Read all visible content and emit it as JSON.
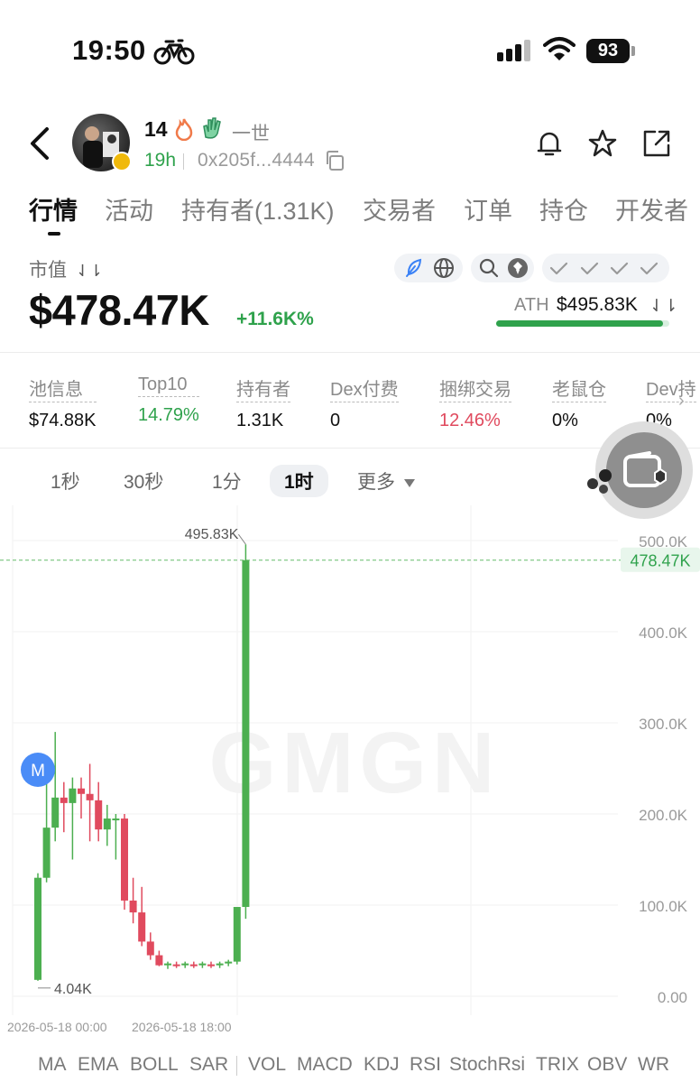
{
  "status_bar": {
    "time": "19:50",
    "battery": "93"
  },
  "token": {
    "name": "14",
    "subtitle": "一世",
    "age": "19h",
    "address": "0x205f...4444"
  },
  "tabs": [
    "行情",
    "活动",
    "持有者(1.31K)",
    "交易者",
    "订单",
    "持仓",
    "开发者"
  ],
  "market": {
    "cap_label": "市值",
    "sort_glyph": "⇃⇂",
    "cap_value": "$478.47K",
    "change": "+11.6K%",
    "ath_label": "ATH",
    "ath_value": "$495.83K",
    "ath_progress": 0.965
  },
  "stats": [
    {
      "label": "池信息",
      "value": "$74.88K",
      "tone": "normal"
    },
    {
      "label": "Top10",
      "value": "14.79%",
      "tone": "green"
    },
    {
      "label": "持有者",
      "value": "1.31K",
      "tone": "normal"
    },
    {
      "label": "Dex付费",
      "value": "0",
      "tone": "normal"
    },
    {
      "label": "捆绑交易",
      "value": "12.46%",
      "tone": "red"
    },
    {
      "label": "老鼠仓",
      "value": "0%",
      "tone": "normal"
    },
    {
      "label": "Dev持",
      "value": "0%",
      "tone": "normal"
    }
  ],
  "intervals": [
    "1秒",
    "30秒",
    "1分",
    "1时",
    "更多"
  ],
  "active_interval": "1时",
  "chart_data": {
    "type": "candlestick",
    "watermark": "GMGN",
    "y_ticks": [
      "500.0K",
      "400.0K",
      "300.0K",
      "200.0K",
      "100.0K",
      "0.00"
    ],
    "y_values": [
      500,
      400,
      300,
      200,
      100,
      0
    ],
    "x_ticks": [
      "2026-05-18 00:00",
      "2026-05-18 18:00"
    ],
    "high_label": "495.83K",
    "low_label": "4.04K",
    "current_label": "478.47K",
    "current_value": 478.47,
    "marker": "M",
    "colors": {
      "up": "#4caf50",
      "down": "#e04a5e"
    },
    "candles": [
      {
        "o": 18,
        "h": 135,
        "l": 17,
        "c": 130
      },
      {
        "o": 130,
        "h": 260,
        "l": 125,
        "c": 185
      },
      {
        "o": 185,
        "h": 290,
        "l": 170,
        "c": 218
      },
      {
        "o": 218,
        "h": 235,
        "l": 180,
        "c": 212
      },
      {
        "o": 212,
        "h": 240,
        "l": 150,
        "c": 228
      },
      {
        "o": 228,
        "h": 240,
        "l": 195,
        "c": 222
      },
      {
        "o": 222,
        "h": 255,
        "l": 170,
        "c": 215
      },
      {
        "o": 215,
        "h": 235,
        "l": 170,
        "c": 183
      },
      {
        "o": 183,
        "h": 210,
        "l": 165,
        "c": 195
      },
      {
        "o": 195,
        "h": 200,
        "l": 150,
        "c": 195
      },
      {
        "o": 195,
        "h": 200,
        "l": 95,
        "c": 105
      },
      {
        "o": 105,
        "h": 130,
        "l": 80,
        "c": 92
      },
      {
        "o": 92,
        "h": 120,
        "l": 55,
        "c": 60
      },
      {
        "o": 60,
        "h": 70,
        "l": 40,
        "c": 45
      },
      {
        "o": 45,
        "h": 50,
        "l": 33,
        "c": 34
      },
      {
        "o": 34,
        "h": 38,
        "l": 30,
        "c": 36
      },
      {
        "o": 35,
        "h": 38,
        "l": 31,
        "c": 34
      },
      {
        "o": 34,
        "h": 38,
        "l": 31,
        "c": 36
      },
      {
        "o": 35,
        "h": 38,
        "l": 31,
        "c": 34
      },
      {
        "o": 34,
        "h": 38,
        "l": 31,
        "c": 36
      },
      {
        "o": 35,
        "h": 38,
        "l": 31,
        "c": 34
      },
      {
        "o": 34,
        "h": 38,
        "l": 31,
        "c": 36
      },
      {
        "o": 36,
        "h": 40,
        "l": 33,
        "c": 38
      },
      {
        "o": 38,
        "h": 45,
        "l": 35,
        "c": 98
      },
      {
        "o": 98,
        "h": 495.83,
        "l": 85,
        "c": 478.47
      }
    ]
  },
  "indicators": [
    "MA",
    "EMA",
    "BOLL",
    "SAR",
    "VOL",
    "MACD",
    "KDJ",
    "RSI",
    "StochRsi",
    "TRIX",
    "OBV",
    "WR"
  ]
}
